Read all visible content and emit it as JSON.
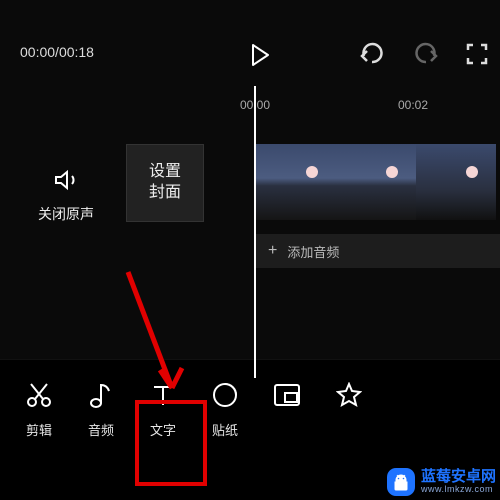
{
  "timecode": {
    "current": "00:00",
    "total": "00:18"
  },
  "ruler": {
    "t0": "00:00",
    "t1": "00:02"
  },
  "mute": {
    "label": "关闭原声"
  },
  "cover": {
    "line1": "设置",
    "line2": "封面"
  },
  "audio": {
    "add": "添加音频"
  },
  "tools": {
    "cut": "剪辑",
    "audio": "音频",
    "text": "文字",
    "sticker": "贴纸"
  },
  "watermark": {
    "title": "蓝莓安卓网",
    "sub": "www.lmkzw.com"
  }
}
